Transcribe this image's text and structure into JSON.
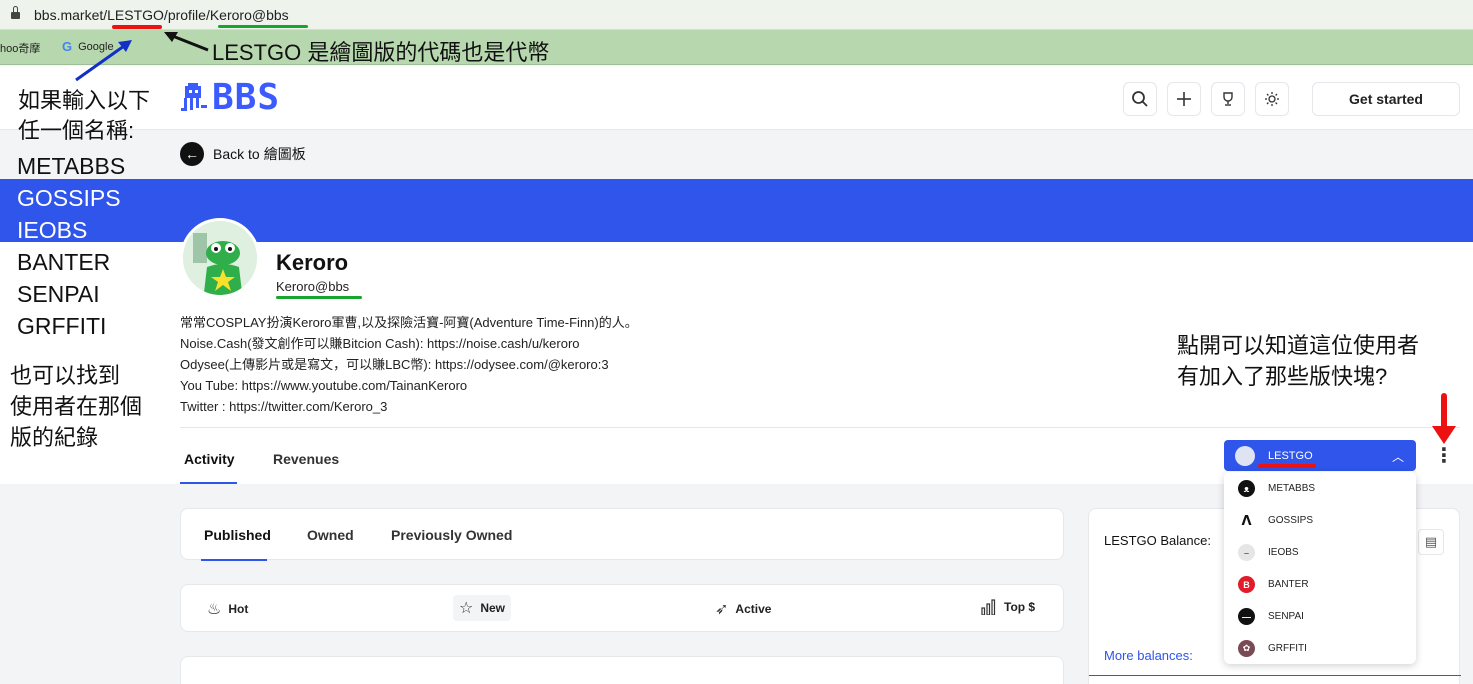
{
  "browser": {
    "url": "bbs.market/LESTGO/profile/Keroro@bbs",
    "bookmarks": [
      {
        "label": "hoo奇摩"
      },
      {
        "label": "Google",
        "icon": "G"
      }
    ]
  },
  "header": {
    "logo_text": "BBS",
    "icons": [
      "search-icon",
      "plus-icon",
      "trophy-icon",
      "sun-icon"
    ],
    "get_started": "Get started"
  },
  "back": {
    "prefix": "Back to",
    "board": "繪圖板"
  },
  "colors": {
    "brand_blue": "#2f55ea",
    "annotation_red": "#e11111",
    "annotation_green": "#18a52d",
    "bookmark_bar": "#b7d8ae"
  },
  "profile": {
    "name": "Keroro",
    "handle": "Keroro@bbs",
    "bio": [
      "常常COSPLAY扮演Keroro軍曹,以及探險活寶-阿寶(Adventure Time-Finn)的人。",
      "Noise.Cash(發文創作可以賺Bitcion Cash): https://noise.cash/u/keroro",
      "Odysee(上傳影片或是寫文，可以賺LBC幣): https://odysee.com/@keroro:3",
      "You Tube: https://www.youtube.com/TainanKeroro",
      "Twitter : https://twitter.com/Keroro_3"
    ],
    "tabs": [
      "Activity",
      "Revenues"
    ]
  },
  "board_selector": {
    "selected": "LESTGO",
    "options": [
      {
        "name": "METABBS",
        "icon": "metabbs-icon",
        "color": "#111111"
      },
      {
        "name": "GOSSIPS",
        "icon": "gossips-icon",
        "color": "#ffffff"
      },
      {
        "name": "IEOBS",
        "icon": "ieobs-icon",
        "color": "#e6e6e6"
      },
      {
        "name": "BANTER",
        "icon": "banter-icon",
        "color": "#e11d2a"
      },
      {
        "name": "SENPAI",
        "icon": "senpai-icon",
        "color": "#111111"
      },
      {
        "name": "GRFFITI",
        "icon": "grffiti-icon",
        "color": "#7a4a55"
      }
    ]
  },
  "feed": {
    "sub_tabs": [
      "Published",
      "Owned",
      "Previously Owned"
    ],
    "sort": [
      {
        "label": "Hot",
        "icon": "fire-icon"
      },
      {
        "label": "New",
        "icon": "star-icon"
      },
      {
        "label": "Active",
        "icon": "rocket-icon"
      },
      {
        "label": "Top $",
        "icon": "bar-chart-icon"
      }
    ]
  },
  "balance": {
    "label": "LESTGO Balance:",
    "more": "More balances:"
  },
  "annotations": {
    "title": "LESTGO 是繪圖版的代碼也是代幣",
    "names_intro": [
      "如果輸入以下",
      "任一個名稱:"
    ],
    "names": [
      "METABBS",
      "GOSSIPS",
      "IEOBS",
      "BANTER",
      "SENPAI",
      "GRFFITI"
    ],
    "find": [
      "也可以找到",
      "使用者在那個",
      "版的紀錄"
    ],
    "dropdown_hint": [
      "點開可以知道這位使用者",
      "有加入了那些版快塊?"
    ]
  }
}
